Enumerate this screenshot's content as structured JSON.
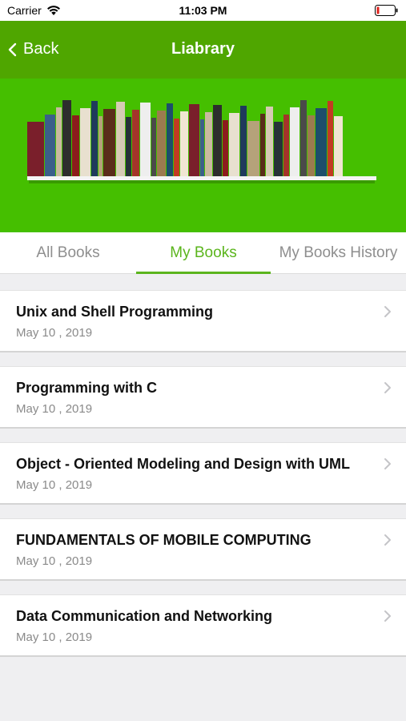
{
  "status_bar": {
    "carrier": "Carrier",
    "time": "11:03 PM"
  },
  "nav": {
    "back_label": "Back",
    "title": "Liabrary"
  },
  "tabs": [
    {
      "label": "All Books"
    },
    {
      "label": "My Books"
    },
    {
      "label": "My Books History"
    }
  ],
  "active_tab": "My Books",
  "books": [
    {
      "title": "Unix and Shell Programming",
      "date": "May 10 , 2019"
    },
    {
      "title": "Programming with C",
      "date": "May 10 , 2019"
    },
    {
      "title": "Object - Oriented Modeling and Design with UML",
      "date": "May 10 , 2019"
    },
    {
      "title": "FUNDAMENTALS OF MOBILE COMPUTING",
      "date": "May 10 , 2019"
    },
    {
      "title": "Data Communication and Networking",
      "date": "May 10 , 2019"
    }
  ],
  "colors": {
    "nav_bg": "#4fa600",
    "banner_bg": "#45bf00",
    "accent": "#5bb51d",
    "battery_low": "#e0201b"
  },
  "icons": [
    "wifi-icon",
    "battery-icon",
    "back-chevron-icon",
    "bookshelf-image",
    "chevron-right-icon"
  ]
}
